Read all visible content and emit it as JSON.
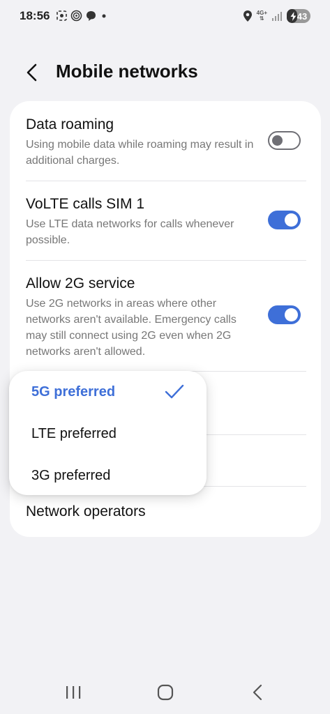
{
  "status_bar": {
    "time": "18:56",
    "network_type": "4G+",
    "battery_level": "43",
    "icons": [
      "screenshot-icon",
      "nfc-icon",
      "chat-icon",
      "dot-icon",
      "location-icon",
      "signal-icon",
      "charging-icon"
    ]
  },
  "header": {
    "title": "Mobile networks"
  },
  "settings": {
    "data_roaming": {
      "title": "Data roaming",
      "subtitle": "Using mobile data while roaming may result in additional charges.",
      "enabled": false
    },
    "volte": {
      "title": "VoLTE calls SIM 1",
      "subtitle": "Use LTE data networks for calls whenever possible.",
      "enabled": true
    },
    "allow_2g": {
      "title": "Allow 2G service",
      "subtitle": "Use 2G networks in areas where other networks aren't available. Emergency calls may still connect using 2G even when 2G networks aren't allowed.",
      "enabled": true
    },
    "network_operators": {
      "title": "Network operators"
    }
  },
  "network_mode_popup": {
    "options": [
      "5G preferred",
      "LTE preferred",
      "3G preferred"
    ],
    "selected": "5G preferred"
  },
  "colors": {
    "accent": "#3e6fd8",
    "background": "#f2f2f5",
    "card": "#ffffff"
  }
}
